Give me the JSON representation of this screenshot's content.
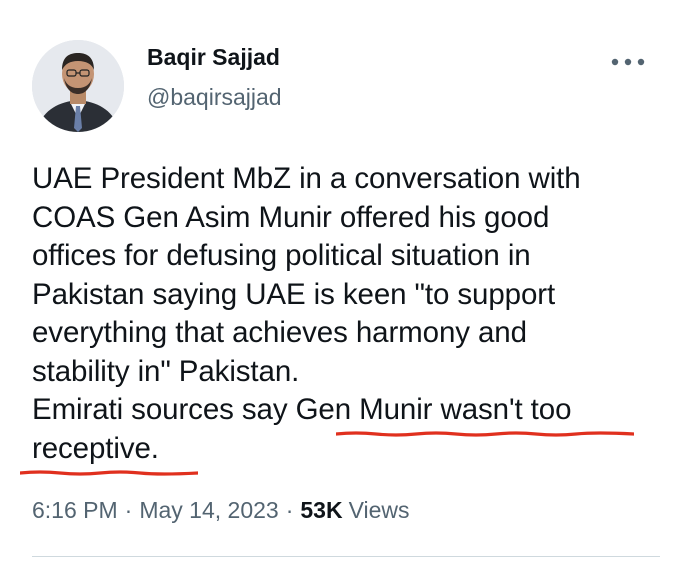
{
  "tweet": {
    "author": {
      "name": "Baqir Sajjad",
      "handle": "@baqirsajjad"
    },
    "text": "UAE President MbZ in a conversation with\nCOAS Gen Asim Munir offered his good\noffices for defusing political situation in\nPakistan saying UAE is keen \"to support\neverything that achieves harmony and\nstability in\" Pakistan.\nEmirati sources say Gen Munir wasn't too\nreceptive.",
    "time": "6:16 PM",
    "separator": "·",
    "date": "May 14, 2023",
    "views_count": "53K",
    "views_label": "Views"
  },
  "icons": {
    "more": "more-horizontal-icon",
    "avatar": "avatar-photo"
  },
  "colors": {
    "text": "#0f1419",
    "secondary": "#536471",
    "divider": "#cfd9de",
    "annotation_underline": "#e0301e"
  }
}
